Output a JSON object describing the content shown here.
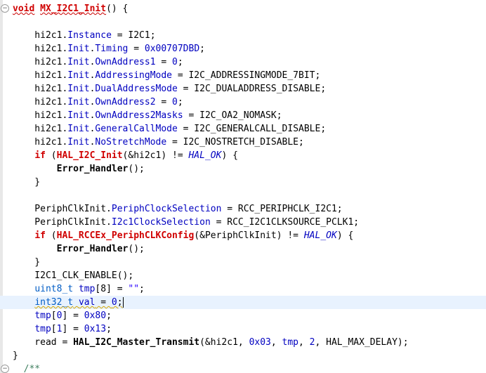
{
  "editor": {
    "fold_open_glyph": "⊖",
    "lines": [
      {
        "id": "l0",
        "tokens": [
          {
            "t": "void",
            "c": "redtext squiggle"
          },
          {
            "t": " ",
            "c": ""
          },
          {
            "t": "MX_I2C1_Init",
            "c": "redtext squiggle"
          },
          {
            "t": "() {",
            "c": ""
          }
        ]
      },
      {
        "id": "l1",
        "tokens": []
      },
      {
        "id": "l2",
        "tokens": [
          {
            "t": "    hi2c1.",
            "c": ""
          },
          {
            "t": "Instance",
            "c": "field"
          },
          {
            "t": " = I2C1;",
            "c": ""
          }
        ]
      },
      {
        "id": "l3",
        "tokens": [
          {
            "t": "    hi2c1.",
            "c": ""
          },
          {
            "t": "Init",
            "c": "field"
          },
          {
            "t": ".",
            "c": ""
          },
          {
            "t": "Timing",
            "c": "field"
          },
          {
            "t": " = ",
            "c": ""
          },
          {
            "t": "0x00707DBD",
            "c": "field"
          },
          {
            "t": ";",
            "c": ""
          }
        ]
      },
      {
        "id": "l4",
        "tokens": [
          {
            "t": "    hi2c1.",
            "c": ""
          },
          {
            "t": "Init",
            "c": "field"
          },
          {
            "t": ".",
            "c": ""
          },
          {
            "t": "OwnAddress1",
            "c": "field"
          },
          {
            "t": " = ",
            "c": ""
          },
          {
            "t": "0",
            "c": "field"
          },
          {
            "t": ";",
            "c": ""
          }
        ]
      },
      {
        "id": "l5",
        "tokens": [
          {
            "t": "    hi2c1.",
            "c": ""
          },
          {
            "t": "Init",
            "c": "field"
          },
          {
            "t": ".",
            "c": ""
          },
          {
            "t": "AddressingMode",
            "c": "field"
          },
          {
            "t": " = I2C_ADDRESSINGMODE_7BIT;",
            "c": ""
          }
        ]
      },
      {
        "id": "l6",
        "tokens": [
          {
            "t": "    hi2c1.",
            "c": ""
          },
          {
            "t": "Init",
            "c": "field"
          },
          {
            "t": ".",
            "c": ""
          },
          {
            "t": "DualAddressMode",
            "c": "field"
          },
          {
            "t": " = I2C_DUALADDRESS_DISABLE;",
            "c": ""
          }
        ]
      },
      {
        "id": "l7",
        "tokens": [
          {
            "t": "    hi2c1.",
            "c": ""
          },
          {
            "t": "Init",
            "c": "field"
          },
          {
            "t": ".",
            "c": ""
          },
          {
            "t": "OwnAddress2",
            "c": "field"
          },
          {
            "t": " = ",
            "c": ""
          },
          {
            "t": "0",
            "c": "field"
          },
          {
            "t": ";",
            "c": ""
          }
        ]
      },
      {
        "id": "l8",
        "tokens": [
          {
            "t": "    hi2c1.",
            "c": ""
          },
          {
            "t": "Init",
            "c": "field"
          },
          {
            "t": ".",
            "c": ""
          },
          {
            "t": "OwnAddress2Masks",
            "c": "field"
          },
          {
            "t": " = I2C_OA2_NOMASK;",
            "c": ""
          }
        ]
      },
      {
        "id": "l9",
        "tokens": [
          {
            "t": "    hi2c1.",
            "c": ""
          },
          {
            "t": "Init",
            "c": "field"
          },
          {
            "t": ".",
            "c": ""
          },
          {
            "t": "GeneralCallMode",
            "c": "field"
          },
          {
            "t": " = I2C_GENERALCALL_DISABLE;",
            "c": ""
          }
        ]
      },
      {
        "id": "l10",
        "tokens": [
          {
            "t": "    hi2c1.",
            "c": ""
          },
          {
            "t": "Init",
            "c": "field"
          },
          {
            "t": ".",
            "c": ""
          },
          {
            "t": "NoStretchMode",
            "c": "field"
          },
          {
            "t": " = I2C_NOSTRETCH_DISABLE;",
            "c": ""
          }
        ]
      },
      {
        "id": "l11",
        "tokens": [
          {
            "t": "    ",
            "c": ""
          },
          {
            "t": "if",
            "c": "redtext"
          },
          {
            "t": " (",
            "c": ""
          },
          {
            "t": "HAL_I2C_Init",
            "c": "redtext"
          },
          {
            "t": "(&hi2c1) != ",
            "c": ""
          },
          {
            "t": "HAL_OK",
            "c": "macro"
          },
          {
            "t": ") {",
            "c": ""
          }
        ]
      },
      {
        "id": "l12",
        "tokens": [
          {
            "t": "        ",
            "c": ""
          },
          {
            "t": "Error_Handler",
            "c": "fn"
          },
          {
            "t": "();",
            "c": ""
          }
        ]
      },
      {
        "id": "l13",
        "tokens": [
          {
            "t": "    }",
            "c": ""
          }
        ]
      },
      {
        "id": "l14",
        "tokens": []
      },
      {
        "id": "l15",
        "tokens": [
          {
            "t": "    PeriphClkInit.",
            "c": ""
          },
          {
            "t": "PeriphClockSelection",
            "c": "field"
          },
          {
            "t": " = RCC_PERIPHCLK_I2C1;",
            "c": ""
          }
        ]
      },
      {
        "id": "l16",
        "tokens": [
          {
            "t": "    PeriphClkInit.",
            "c": ""
          },
          {
            "t": "I2c1ClockSelection",
            "c": "field"
          },
          {
            "t": " = RCC_I2C1CLKSOURCE_PCLK1;",
            "c": ""
          }
        ]
      },
      {
        "id": "l17",
        "tokens": [
          {
            "t": "    ",
            "c": ""
          },
          {
            "t": "if",
            "c": "redtext"
          },
          {
            "t": " (",
            "c": ""
          },
          {
            "t": "HAL_RCCEx_PeriphCLKConfig",
            "c": "redtext"
          },
          {
            "t": "(&PeriphClkInit) != ",
            "c": ""
          },
          {
            "t": "HAL_OK",
            "c": "macro"
          },
          {
            "t": ") {",
            "c": ""
          }
        ]
      },
      {
        "id": "l18",
        "tokens": [
          {
            "t": "        ",
            "c": ""
          },
          {
            "t": "Error_Handler",
            "c": "fn"
          },
          {
            "t": "();",
            "c": ""
          }
        ]
      },
      {
        "id": "l19",
        "tokens": [
          {
            "t": "    }",
            "c": ""
          }
        ]
      },
      {
        "id": "l20",
        "tokens": [
          {
            "t": "    I2C1_CLK_ENABLE();",
            "c": ""
          }
        ]
      },
      {
        "id": "l21",
        "tokens": [
          {
            "t": "    ",
            "c": ""
          },
          {
            "t": "uint8_t",
            "c": "typeblue"
          },
          {
            "t": " ",
            "c": ""
          },
          {
            "t": "tmp",
            "c": "field"
          },
          {
            "t": "[8] = ",
            "c": ""
          },
          {
            "t": "\"\"",
            "c": "str"
          },
          {
            "t": ";",
            "c": ""
          }
        ]
      },
      {
        "id": "l22",
        "current": true,
        "tokens": [
          {
            "t": "    ",
            "c": ""
          },
          {
            "t": "int32_t",
            "c": "typeblue yellow-sq"
          },
          {
            "t": " ",
            "c": "yellow-sq"
          },
          {
            "t": "val",
            "c": "field yellow-sq"
          },
          {
            "t": " = ",
            "c": "yellow-sq"
          },
          {
            "t": "0",
            "c": "field yellow-sq"
          },
          {
            "t": ";",
            "c": "yellow-sq"
          },
          {
            "t": "|CARET|",
            "c": ""
          }
        ]
      },
      {
        "id": "l23",
        "tokens": [
          {
            "t": "    ",
            "c": ""
          },
          {
            "t": "tmp",
            "c": "field"
          },
          {
            "t": "[",
            "c": ""
          },
          {
            "t": "0",
            "c": "field"
          },
          {
            "t": "] = ",
            "c": ""
          },
          {
            "t": "0x80",
            "c": "field"
          },
          {
            "t": ";",
            "c": ""
          }
        ]
      },
      {
        "id": "l24",
        "tokens": [
          {
            "t": "    ",
            "c": ""
          },
          {
            "t": "tmp",
            "c": "field"
          },
          {
            "t": "[",
            "c": ""
          },
          {
            "t": "1",
            "c": "field"
          },
          {
            "t": "] = ",
            "c": ""
          },
          {
            "t": "0x13",
            "c": "field"
          },
          {
            "t": ";",
            "c": ""
          }
        ]
      },
      {
        "id": "l25",
        "tokens": [
          {
            "t": "    read = ",
            "c": ""
          },
          {
            "t": "HAL_I2C_Master_Transmit",
            "c": "fn"
          },
          {
            "t": "(&hi2c1, ",
            "c": ""
          },
          {
            "t": "0x03",
            "c": "field"
          },
          {
            "t": ", ",
            "c": ""
          },
          {
            "t": "tmp",
            "c": "field"
          },
          {
            "t": ", ",
            "c": ""
          },
          {
            "t": "2",
            "c": "field"
          },
          {
            "t": ", HAL_MAX_DELAY);",
            "c": ""
          }
        ]
      },
      {
        "id": "l26",
        "tokens": [
          {
            "t": "}",
            "c": ""
          }
        ]
      },
      {
        "id": "l27",
        "fold": true,
        "tokens": [
          {
            "t": "  ",
            "c": ""
          },
          {
            "t": "/**",
            "c": "comment"
          }
        ]
      }
    ]
  }
}
